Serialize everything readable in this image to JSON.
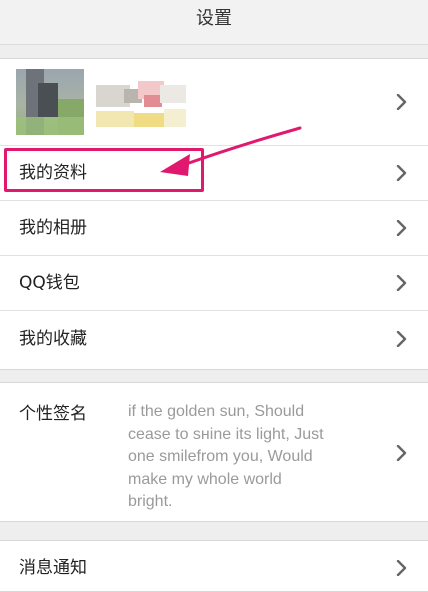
{
  "header": {
    "title": "设置"
  },
  "menu": {
    "profile_label": "我的资料",
    "album_label": "我的相册",
    "wallet_label": "QQ钱包",
    "favorites_label": "我的收藏"
  },
  "signature": {
    "label": "个性签名",
    "lines": [
      "if the golden sun, Should",
      "cease to sнine its light, Just",
      "one smilefrom you, Would",
      "make my whole world",
      "bright."
    ]
  },
  "notifications": {
    "label": "消息通知"
  },
  "colors": {
    "annotation": "#e0186e",
    "background": "#eeeeee",
    "row_background": "#ffffff",
    "signature_text": "#9a9a9a"
  },
  "icons": {
    "chevron": "chevron-right-icon",
    "annotation": "arrow-icon"
  }
}
